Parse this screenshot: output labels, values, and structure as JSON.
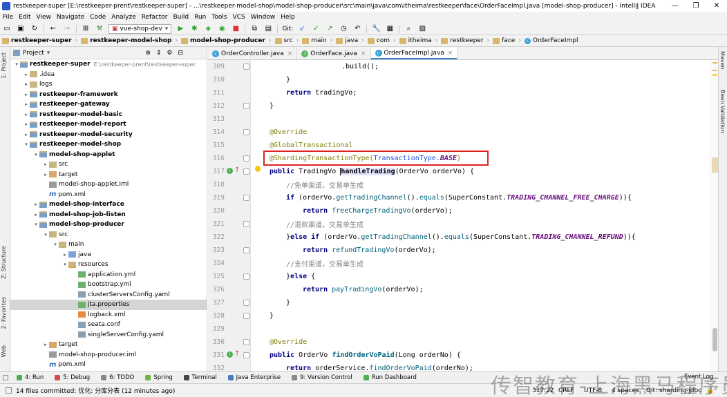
{
  "window": {
    "title": "restkeeper-super [E:\\restkeeper-prent\\restkeeper-super] - ...\\restkeeper-model-shop\\model-shop-producer\\src\\main\\java\\com\\itheima\\restkeeper\\face\\OrderFaceImpl.java [model-shop-producer] - IntelliJ IDEA",
    "controls": {
      "minimize": "—",
      "restore": "❐",
      "close": "✕"
    }
  },
  "menu": [
    "File",
    "Edit",
    "View",
    "Navigate",
    "Code",
    "Analyze",
    "Refactor",
    "Build",
    "Run",
    "Tools",
    "VCS",
    "Window",
    "Help"
  ],
  "toolbar": {
    "run_config": "vue-shop-dev",
    "git_label": "Git:"
  },
  "breadcrumbs": [
    "restkeeper-super",
    "restkeeper-model-shop",
    "model-shop-producer",
    "src",
    "main",
    "java",
    "com",
    "itheima",
    "restkeeper",
    "face",
    "OrderFaceImpl"
  ],
  "sidebar_left": {
    "project": "1: Project",
    "structure": "Z: Structure",
    "favorites": "2: Favorites",
    "web": "Web"
  },
  "sidebar_right": {
    "maven": "Maven",
    "bean_validation": "Bean Validation"
  },
  "project_panel": {
    "title": "Project",
    "tree": [
      {
        "label": "restkeeper-super",
        "extra": "E:\\restkeeper-prent\\restkeeper-super",
        "bold": true,
        "arrow": "▾",
        "icon": "mfolder"
      },
      {
        "label": ".idea",
        "arrow": "▸",
        "icon": "folder"
      },
      {
        "label": "logs",
        "arrow": "▸",
        "icon": "folder"
      },
      {
        "label": "restkeeper-framework",
        "bold": true,
        "arrow": "▸",
        "icon": "mfolder"
      },
      {
        "label": "restkeeper-gateway",
        "bold": true,
        "arrow": "▸",
        "icon": "mfolder"
      },
      {
        "label": "restkeeper-model-basic",
        "bold": true,
        "arrow": "▸",
        "icon": "mfolder"
      },
      {
        "label": "restkeeper-model-report",
        "bold": true,
        "arrow": "▸",
        "icon": "mfolder"
      },
      {
        "label": "restkeeper-model-security",
        "bold": true,
        "arrow": "▸",
        "icon": "mfolder"
      },
      {
        "label": "restkeeper-model-shop",
        "bold": true,
        "arrow": "▾",
        "icon": "mfolder"
      },
      {
        "label": "model-shop-applet",
        "bold": true,
        "arrow": "▾",
        "icon": "mfolder"
      },
      {
        "label": "src",
        "arrow": "▸",
        "icon": "folder"
      },
      {
        "label": "target",
        "arrow": "▸",
        "icon": "target"
      },
      {
        "label": "model-shop-applet.iml",
        "icon": "iml"
      },
      {
        "label": "pom.xml",
        "icon": "pom"
      },
      {
        "label": "model-shop-interface",
        "bold": true,
        "arrow": "▸",
        "icon": "mfolder"
      },
      {
        "label": "model-shop-job-listen",
        "bold": true,
        "arrow": "▸",
        "icon": "mfolder"
      },
      {
        "label": "model-shop-producer",
        "bold": true,
        "arrow": "▾",
        "icon": "mfolder"
      },
      {
        "label": "src",
        "arrow": "▾",
        "icon": "folder"
      },
      {
        "label": "main",
        "arrow": "▾",
        "icon": "folder"
      },
      {
        "label": "java",
        "arrow": "▸",
        "icon": "src"
      },
      {
        "label": "resources",
        "arrow": "▾",
        "icon": "res"
      },
      {
        "label": "application.yml",
        "icon": "yml"
      },
      {
        "label": "bootstrap.yml",
        "icon": "yml"
      },
      {
        "label": "clusterServersConfig.yaml",
        "icon": "conf"
      },
      {
        "label": "jta.properties",
        "icon": "prop",
        "selected": true
      },
      {
        "label": "logback.xml",
        "icon": "xml"
      },
      {
        "label": "seata.conf",
        "icon": "conf"
      },
      {
        "label": "singleServerConfig.yaml",
        "icon": "conf"
      },
      {
        "label": "target",
        "arrow": "▸",
        "icon": "target"
      },
      {
        "label": "model-shop-producer.iml",
        "icon": "iml"
      },
      {
        "label": "pom.xml",
        "icon": "pom"
      }
    ]
  },
  "tabs": [
    {
      "label": "OrderController.java",
      "icon_letter": "c",
      "icon_color": "#3aa0d8"
    },
    {
      "label": "OrderFace.java",
      "icon_letter": "I",
      "icon_color": "#5fb55f"
    },
    {
      "label": "OrderFaceImpl.java",
      "icon_letter": "c",
      "icon_color": "#3aa0d8",
      "active": true
    }
  ],
  "code": {
    "line_numbers": [
      "309",
      "310",
      "311",
      "312",
      "313",
      "314",
      "315",
      "316",
      "317",
      "318",
      "319",
      "320",
      "321",
      "322",
      "323",
      "324",
      "325",
      "326",
      "327",
      "328",
      "329",
      "330",
      "331",
      "332"
    ],
    "l309": ".build();",
    "l310": "}",
    "l311_kw": "return",
    "l311_rest": " tradingVo;",
    "l312": "}",
    "l314": "@Override",
    "l315": "@GlobalTransactional",
    "l316_ann": "@ShardingTransactionType(",
    "l316_type": "TransactionType.",
    "l316_const": "BASE",
    "l316_end": ")",
    "l317_kw": "public",
    "l317_type": " TradingVo ",
    "l317_method": "handleTrading",
    "l317_rest": "(OrderVo orderVo) {",
    "l318": "//免单渠道，交易单生成",
    "l319_kw": "if",
    "l319_a": " (orderVo.",
    "l319_fn1": "getTradingChannel",
    "l319_b": "().",
    "l319_fn2": "equals",
    "l319_c": "(SuperConstant.",
    "l319_const": "TRADING_CHANNEL_FREE_CHARGE",
    "l319_d": ")){",
    "l320_kw": "return",
    "l320_fn": " freeChargeTradingVo",
    "l320_rest": "(orderVo);",
    "l321": "//退款渠道，交易单生成",
    "l322_a": "}",
    "l322_kw": "else if",
    "l322_b": " (orderVo.",
    "l322_fn1": "getTradingChannel",
    "l322_c": "().",
    "l322_fn2": "equals",
    "l322_d": "(SuperConstant.",
    "l322_const": "TRADING_CHANNEL_REFUND",
    "l322_e": ")){",
    "l323_kw": "return",
    "l323_fn": " refundTradingVo",
    "l323_rest": "(orderVo);",
    "l324": "//支付渠道，交易单生成",
    "l325_a": "}",
    "l325_kw": "else",
    "l325_b": " {",
    "l326_kw": "return",
    "l326_fn": " payTradingVo",
    "l326_rest": "(orderVo);",
    "l327": "}",
    "l328": "}",
    "l330": "@Override",
    "l331_kw": "public",
    "l331_type": " OrderVo ",
    "l331_method": "findOrderVoPaid",
    "l331_rest": "(Long orderNo) {",
    "l332_kw": "return",
    "l332_a": " orderService.",
    "l332_fn": "findOrderVoPaid",
    "l332_rest": "(orderNo);"
  },
  "bottom_tools": [
    {
      "label": "4: Run",
      "color": "#4caf50"
    },
    {
      "label": "5: Debug",
      "color": "#d64a4a"
    },
    {
      "label": "6: TODO",
      "color": "#888888"
    },
    {
      "label": "Spring",
      "color": "#6db33f"
    },
    {
      "label": "Terminal",
      "color": "#444444"
    },
    {
      "label": "Java Enterprise",
      "color": "#4a7ac0"
    },
    {
      "label": "9: Version Control",
      "color": "#888888"
    },
    {
      "label": "Run Dashboard",
      "color": "#4caf50"
    }
  ],
  "event_log": "Event Log",
  "status": {
    "message": "14 files committed: 优化: 分库分表 (12 minutes ago)",
    "position": "317:22",
    "line_sep": "CRLF",
    "encoding": "UTF-8",
    "indent": "4 spaces",
    "branch": "Git: sharding-jdbc"
  },
  "watermark": "传智教育-上海黑马程序员"
}
